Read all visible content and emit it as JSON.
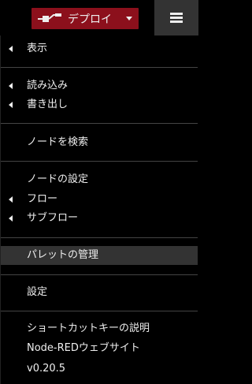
{
  "header": {
    "deploy_label": "デプロイ"
  },
  "menu": {
    "view": "表示",
    "import": "読み込み",
    "export": "書き出し",
    "search": "ノードを検索",
    "config_nodes": "ノードの設定",
    "flows": "フロー",
    "subflows": "サブフロー",
    "palette": "パレットの管理",
    "settings": "設定",
    "shortcuts": "ショートカットキーの説明",
    "website": "Node-REDウェブサイト",
    "version": "v0.20.5"
  },
  "colors": {
    "deploy_bg": "#8c101c",
    "menu_bg": "#000000",
    "highlight_bg": "#333333",
    "separator": "#444444"
  }
}
